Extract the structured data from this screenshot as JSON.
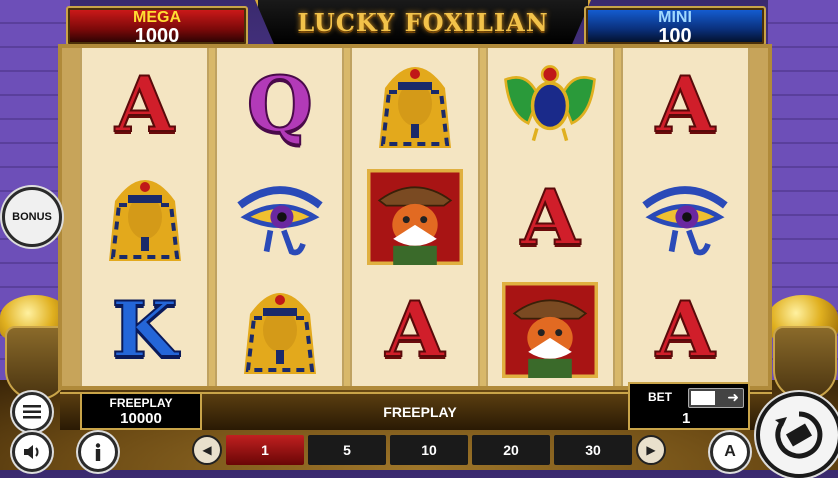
{
  "game_title": "LUCKY FOXILIAN",
  "jackpots": {
    "mega": {
      "label": "MEGA",
      "value": "1000",
      "color": "#d21a1a"
    },
    "mini": {
      "label": "MINI",
      "value": "100",
      "color": "#1560d8"
    }
  },
  "reels": [
    [
      "A",
      "pharaoh",
      "K"
    ],
    [
      "Q",
      "eye-of-horus",
      "pharaoh"
    ],
    [
      "pharaoh",
      "fox-wild",
      "A"
    ],
    [
      "scarab",
      "A",
      "fox-wild"
    ],
    [
      "A",
      "eye-of-horus",
      "A"
    ]
  ],
  "symbols": {
    "A": "A",
    "Q": "Q",
    "K": "K"
  },
  "freeplay": {
    "label": "FREEPLAY",
    "value": "10000"
  },
  "status_text": "FREEPLAY",
  "bet": {
    "label": "BET",
    "value": "1"
  },
  "bet_options": [
    "1",
    "5",
    "10",
    "20",
    "30"
  ],
  "bet_selected_index": 0,
  "buttons": {
    "bonus_label": "BONUS",
    "menu_icon": "hamburger-icon",
    "sound_icon": "speaker-icon",
    "info_icon": "info-icon",
    "auto_label": "A",
    "spin_icon": "spin-arrows-icon",
    "prev_icon": "chevron-left-icon",
    "next_icon": "chevron-right-icon"
  },
  "colors": {
    "accent_gold": "#c9a449",
    "active_bet": "#c02020"
  }
}
